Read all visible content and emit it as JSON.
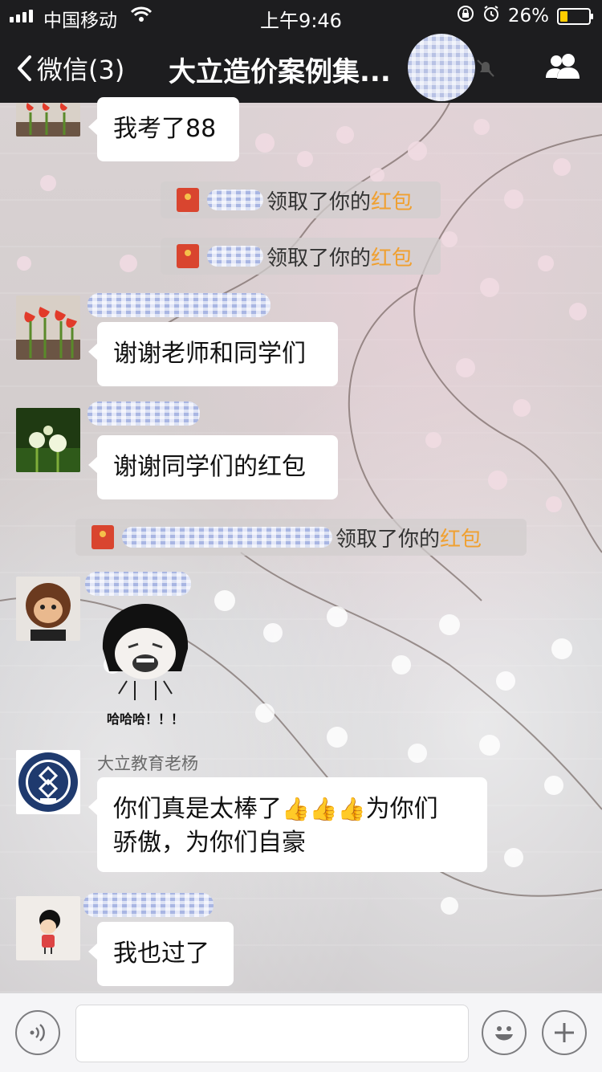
{
  "status_bar": {
    "carrier": "中国移动",
    "time": "上午9:46",
    "battery_percent": "26%",
    "battery_level": 0.26
  },
  "header": {
    "back_label": "微信(3)",
    "title": "大立造价案例集..."
  },
  "messages": [
    {
      "type": "text",
      "text": "我考了88"
    },
    {
      "type": "system",
      "action": "领取了你的",
      "packet": "红包"
    },
    {
      "type": "system",
      "action": "领取了你的",
      "packet": "红包"
    },
    {
      "type": "text",
      "text": "谢谢老师和同学们"
    },
    {
      "type": "text",
      "text": "谢谢同学们的红包"
    },
    {
      "type": "system",
      "action": "领取了你的",
      "packet": "红包"
    },
    {
      "type": "sticker",
      "caption": "哈哈哈！！！"
    },
    {
      "type": "text",
      "sender": "大立教育老杨",
      "text_before": "你们真是太棒了",
      "text_after": "为你们",
      "line2": "骄傲，为你们自豪"
    },
    {
      "type": "text",
      "text": "我也过了"
    }
  ],
  "icons": {
    "back": "chevron-left-icon",
    "mute": "bell-muted-icon",
    "group": "people-icon",
    "voice": "voice-icon",
    "emoji": "smiley-icon",
    "more": "plus-icon",
    "thumbs": "thumbs-up-icon"
  },
  "colors": {
    "bar_bg": "#1d1d1f",
    "red_packet_text": "#f0a030",
    "battery": "#ffcc00"
  }
}
